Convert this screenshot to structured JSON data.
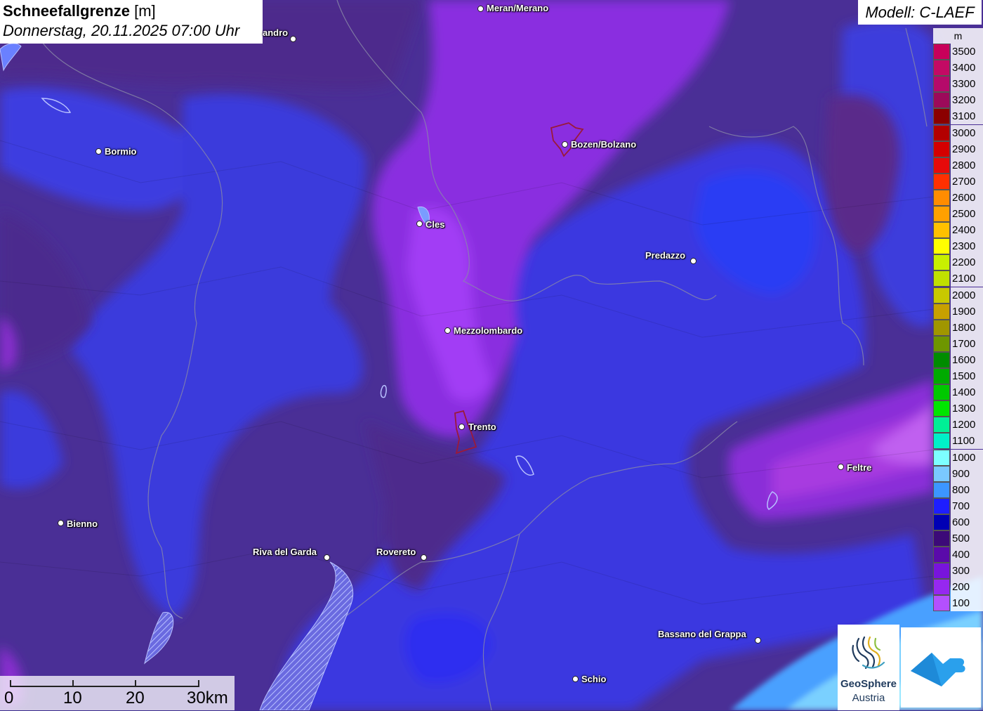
{
  "title": {
    "name": "Schneefallgrenze",
    "unit": "[m]",
    "datetime": "Donnerstag, 20.11.2025 07:00 Uhr"
  },
  "model": "Modell: C-LAEF",
  "legend": {
    "unit": "m",
    "items": [
      {
        "label": "3500",
        "color": "#c8005a"
      },
      {
        "label": "3400",
        "color": "#c30a64"
      },
      {
        "label": "3300",
        "color": "#b50a6a"
      },
      {
        "label": "3200",
        "color": "#9c0a5a"
      },
      {
        "label": "3100",
        "color": "#8b0000"
      },
      {
        "label": "3000",
        "color": "#b30000"
      },
      {
        "label": "2900",
        "color": "#d40000"
      },
      {
        "label": "2800",
        "color": "#e60a0a"
      },
      {
        "label": "2700",
        "color": "#ff3000"
      },
      {
        "label": "2600",
        "color": "#ff8c00"
      },
      {
        "label": "2500",
        "color": "#ffa000"
      },
      {
        "label": "2400",
        "color": "#ffc000"
      },
      {
        "label": "2300",
        "color": "#ffff00"
      },
      {
        "label": "2200",
        "color": "#c8f000"
      },
      {
        "label": "2100",
        "color": "#c0e000"
      },
      {
        "label": "2000",
        "color": "#c8c800"
      },
      {
        "label": "1900",
        "color": "#c8a000"
      },
      {
        "label": "1800",
        "color": "#a09600"
      },
      {
        "label": "1700",
        "color": "#6e9600"
      },
      {
        "label": "1600",
        "color": "#008c00"
      },
      {
        "label": "1500",
        "color": "#00aa00"
      },
      {
        "label": "1400",
        "color": "#00c800"
      },
      {
        "label": "1300",
        "color": "#00e600"
      },
      {
        "label": "1200",
        "color": "#00f096"
      },
      {
        "label": "1100",
        "color": "#00f0c8"
      },
      {
        "label": "1000",
        "color": "#7dffff"
      },
      {
        "label": "900",
        "color": "#7ac8ff"
      },
      {
        "label": "800",
        "color": "#3c96ff"
      },
      {
        "label": "700",
        "color": "#1e1eff"
      },
      {
        "label": "600",
        "color": "#0000b4"
      },
      {
        "label": "500",
        "color": "#3c0a78"
      },
      {
        "label": "400",
        "color": "#5a0aaa"
      },
      {
        "label": "300",
        "color": "#7814dc"
      },
      {
        "label": "200",
        "color": "#9628f0"
      },
      {
        "label": "100",
        "color": "#b450ff"
      }
    ]
  },
  "cities": {
    "meran": "Meran/Merano",
    "sondrio": "andro",
    "bormio": "Bormio",
    "bozen": "Bozen/Bolzano",
    "cles": "Cles",
    "predazzo": "Predazzo",
    "mezzolombardo": "Mezzolombardo",
    "trento": "Trento",
    "feltre": "Feltre",
    "bienno": "Bienno",
    "riva": "Riva del Garda",
    "rovereto": "Rovereto",
    "bassano": "Bassano del Grappa",
    "schio": "Schio"
  },
  "scale": {
    "labels": [
      "0",
      "10",
      "20",
      "30km"
    ]
  },
  "logos": {
    "geosphere_name": "GeoSphere",
    "geosphere_sub": "Austria"
  },
  "icons": {
    "geosphere": "geosphere-logo-icon",
    "partner": "cloud-mountain-logo-icon"
  }
}
